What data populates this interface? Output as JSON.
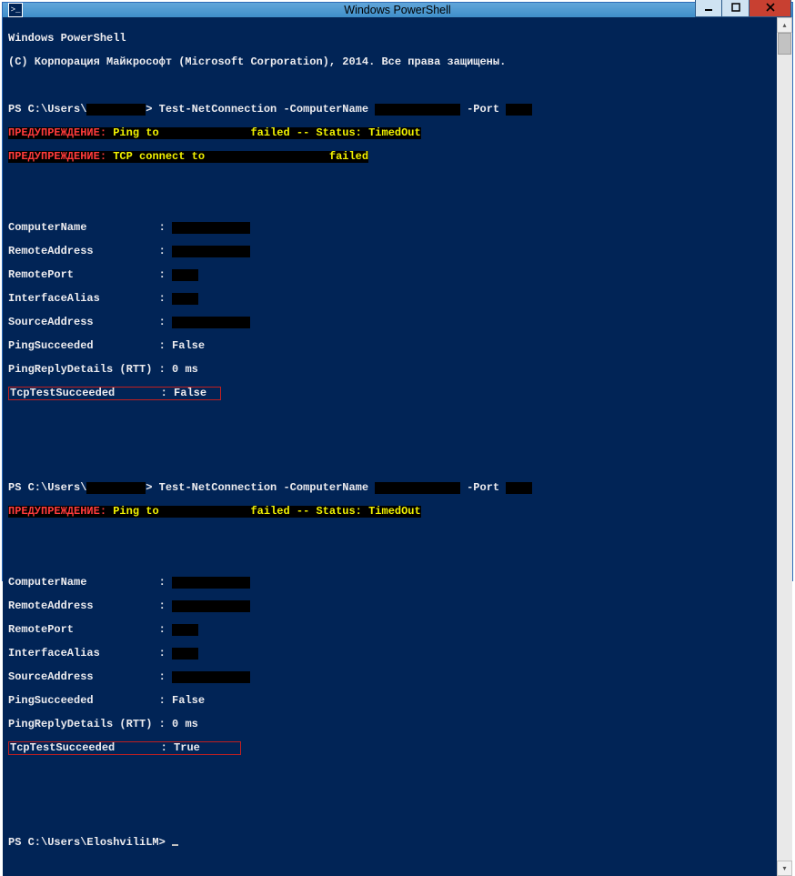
{
  "window": {
    "title": "Windows PowerShell"
  },
  "banner": {
    "line1": "Windows PowerShell",
    "line2": "(С) Корпорация Майкрософт (Microsoft Corporation), 2014. Все права защищены."
  },
  "cmd1": {
    "prompt_prefix": "PS C:\\Users\\",
    "user_mask": "         ",
    "prompt_suffix": "> ",
    "cmd_a": "Test-NetConnection -ComputerName ",
    "host_mask": "             ",
    "cmd_b": " -Port ",
    "port_mask": "    "
  },
  "warn1": {
    "label": "ПРЕДУПРЕЖДЕНИЕ:",
    "tail1a": " Ping to ",
    "mask1": "            ",
    "tail1b": " failed -- Status: TimedOut",
    "tail2a": " TCP connect to ",
    "mask2": "                 ",
    "tail2b": " failed"
  },
  "result1": {
    "rows": [
      {
        "k": "ComputerName           ",
        "sep": ": ",
        "mask": "            "
      },
      {
        "k": "RemoteAddress          ",
        "sep": ": ",
        "mask": "            "
      },
      {
        "k": "RemotePort             ",
        "sep": ": ",
        "mask": "    "
      },
      {
        "k": "InterfaceAlias         ",
        "sep": ": ",
        "mask": "    "
      },
      {
        "k": "SourceAddress          ",
        "sep": ": ",
        "mask": "            "
      }
    ],
    "pingSucceeded_k": "PingSucceeded          ",
    "pingSucceeded_v": ": False",
    "pingRtt_k": "PingReplyDetails (RTT) ",
    "pingRtt_v": ": 0 ms",
    "tcp_k": "TcpTestSucceeded       ",
    "tcp_v": ": False"
  },
  "cmd2": {
    "prompt_prefix": "PS C:\\Users\\",
    "user_mask": "         ",
    "prompt_suffix": "> ",
    "cmd_a": "Test-NetConnection -ComputerName ",
    "host_mask": "             ",
    "cmd_b": " -Port ",
    "port_mask": "    "
  },
  "warn2": {
    "label": "ПРЕДУПРЕЖДЕНИЕ:",
    "taila": " Ping to ",
    "mask": "            ",
    "tailb": " failed -- Status: TimedOut"
  },
  "result2": {
    "rows": [
      {
        "k": "ComputerName           ",
        "sep": ": ",
        "mask": "            "
      },
      {
        "k": "RemoteAddress          ",
        "sep": ": ",
        "mask": "            "
      },
      {
        "k": "RemotePort             ",
        "sep": ": ",
        "mask": "    "
      },
      {
        "k": "InterfaceAlias         ",
        "sep": ": ",
        "mask": "    "
      },
      {
        "k": "SourceAddress          ",
        "sep": ": ",
        "mask": "            "
      }
    ],
    "pingSucceeded_k": "PingSucceeded          ",
    "pingSucceeded_v": ": False",
    "pingRtt_k": "PingReplyDetails (RTT) ",
    "pingRtt_v": ": 0 ms",
    "tcp_k": "TcpTestSucceeded       ",
    "tcp_v": ": True"
  },
  "final_prompt": "PS C:\\Users\\EloshviliLM> "
}
